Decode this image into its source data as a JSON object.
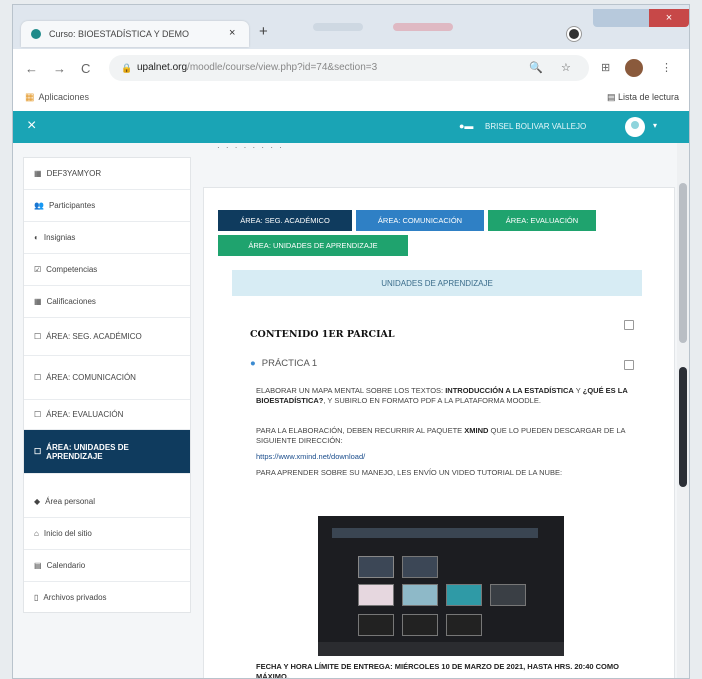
{
  "browser": {
    "tab_title": "Curso: BIOESTADÍSTICA Y DEMO",
    "tab_close": "×",
    "new_tab": "+",
    "url_domain": "upalnet.org",
    "url_path": "/moodle/course/view.php?id=74&section=3",
    "back": "←",
    "forward": "→",
    "reload": "C",
    "apps_label": "Aplicaciones",
    "reading_list": "Lista de lectura",
    "win_close": "×"
  },
  "navbar": {
    "close": "×",
    "user_name": "BRISEL BOLIVAR VALLEJO"
  },
  "sidebar": {
    "items": [
      {
        "icon": "▦",
        "label": "DEF3YAMYOR"
      },
      {
        "icon": "👥",
        "label": "Participantes"
      },
      {
        "icon": "◐",
        "label": "Insignias"
      },
      {
        "icon": "☑",
        "label": "Competencias"
      },
      {
        "icon": "▦",
        "label": "Calificaciones"
      },
      {
        "icon": "☐",
        "label": "ÁREA: SEG. ACADÉMICO"
      },
      {
        "icon": "☐",
        "label": "ÁREA: COMUNICACIÓN"
      },
      {
        "icon": "☐",
        "label": "ÁREA: EVALUACIÓN"
      },
      {
        "icon": "☐",
        "label": "ÁREA: UNIDADES DE APRENDIZAJE"
      },
      {
        "icon": "◆",
        "label": "Área personal"
      },
      {
        "icon": "⌂",
        "label": "Inicio del sitio"
      },
      {
        "icon": "▤",
        "label": "Calendario"
      },
      {
        "icon": "▯",
        "label": "Archivos privados"
      }
    ]
  },
  "main": {
    "top_strip": "· · · · · · · ·",
    "tabs": [
      {
        "label": "ÁREA: SEG. ACADÉMICO",
        "color": "#0f3b5e"
      },
      {
        "label": "ÁREA: COMUNICACIÓN",
        "color": "#2f80c5"
      },
      {
        "label": "ÁREA: EVALUACIÓN",
        "color": "#1fa36e"
      },
      {
        "label": "ÁREA: UNIDADES DE APRENDIZAJE",
        "color": "#1fa36e"
      }
    ],
    "section_title": "UNIDADES DE APRENDIZAJE",
    "contenido": "CONTENIDO 1ER PARCIAL",
    "practica": "PRÁCTICA 1",
    "p1_a": "ELABORAR UN MAPA MENTAL SOBRE LOS TEXTOS: ",
    "p1_b": "INTRODUCCIÓN A LA ESTADÍSTICA",
    "p1_c": " Y ",
    "p1_d": "¿QUÉ ES LA BIOESTADÍSTICA?",
    "p1_e": ", Y SUBIRLO EN FORMATO PDF A LA PLATAFORMA MOODLE.",
    "p2_a": "PARA LA ELABORACIÓN, DEBEN RECURRIR AL PAQUETE ",
    "p2_b": "XMIND",
    "p2_c": " QUE LO PUEDEN DESCARGAR DE LA SIGUIENTE DIRECCIÓN:",
    "link": "https://www.xmind.net/download/",
    "p3": "PARA APRENDER SOBRE SU MANEJO, LES ENVÍO UN VIDEO TUTORIAL DE LA NUBE:",
    "deadline": "FECHA Y HORA LÍMITE DE ENTREGA: MIÉRCOLES 10 DE MARZO DE 2021, HASTA HRS. 20:40 COMO MÁXIMO."
  }
}
